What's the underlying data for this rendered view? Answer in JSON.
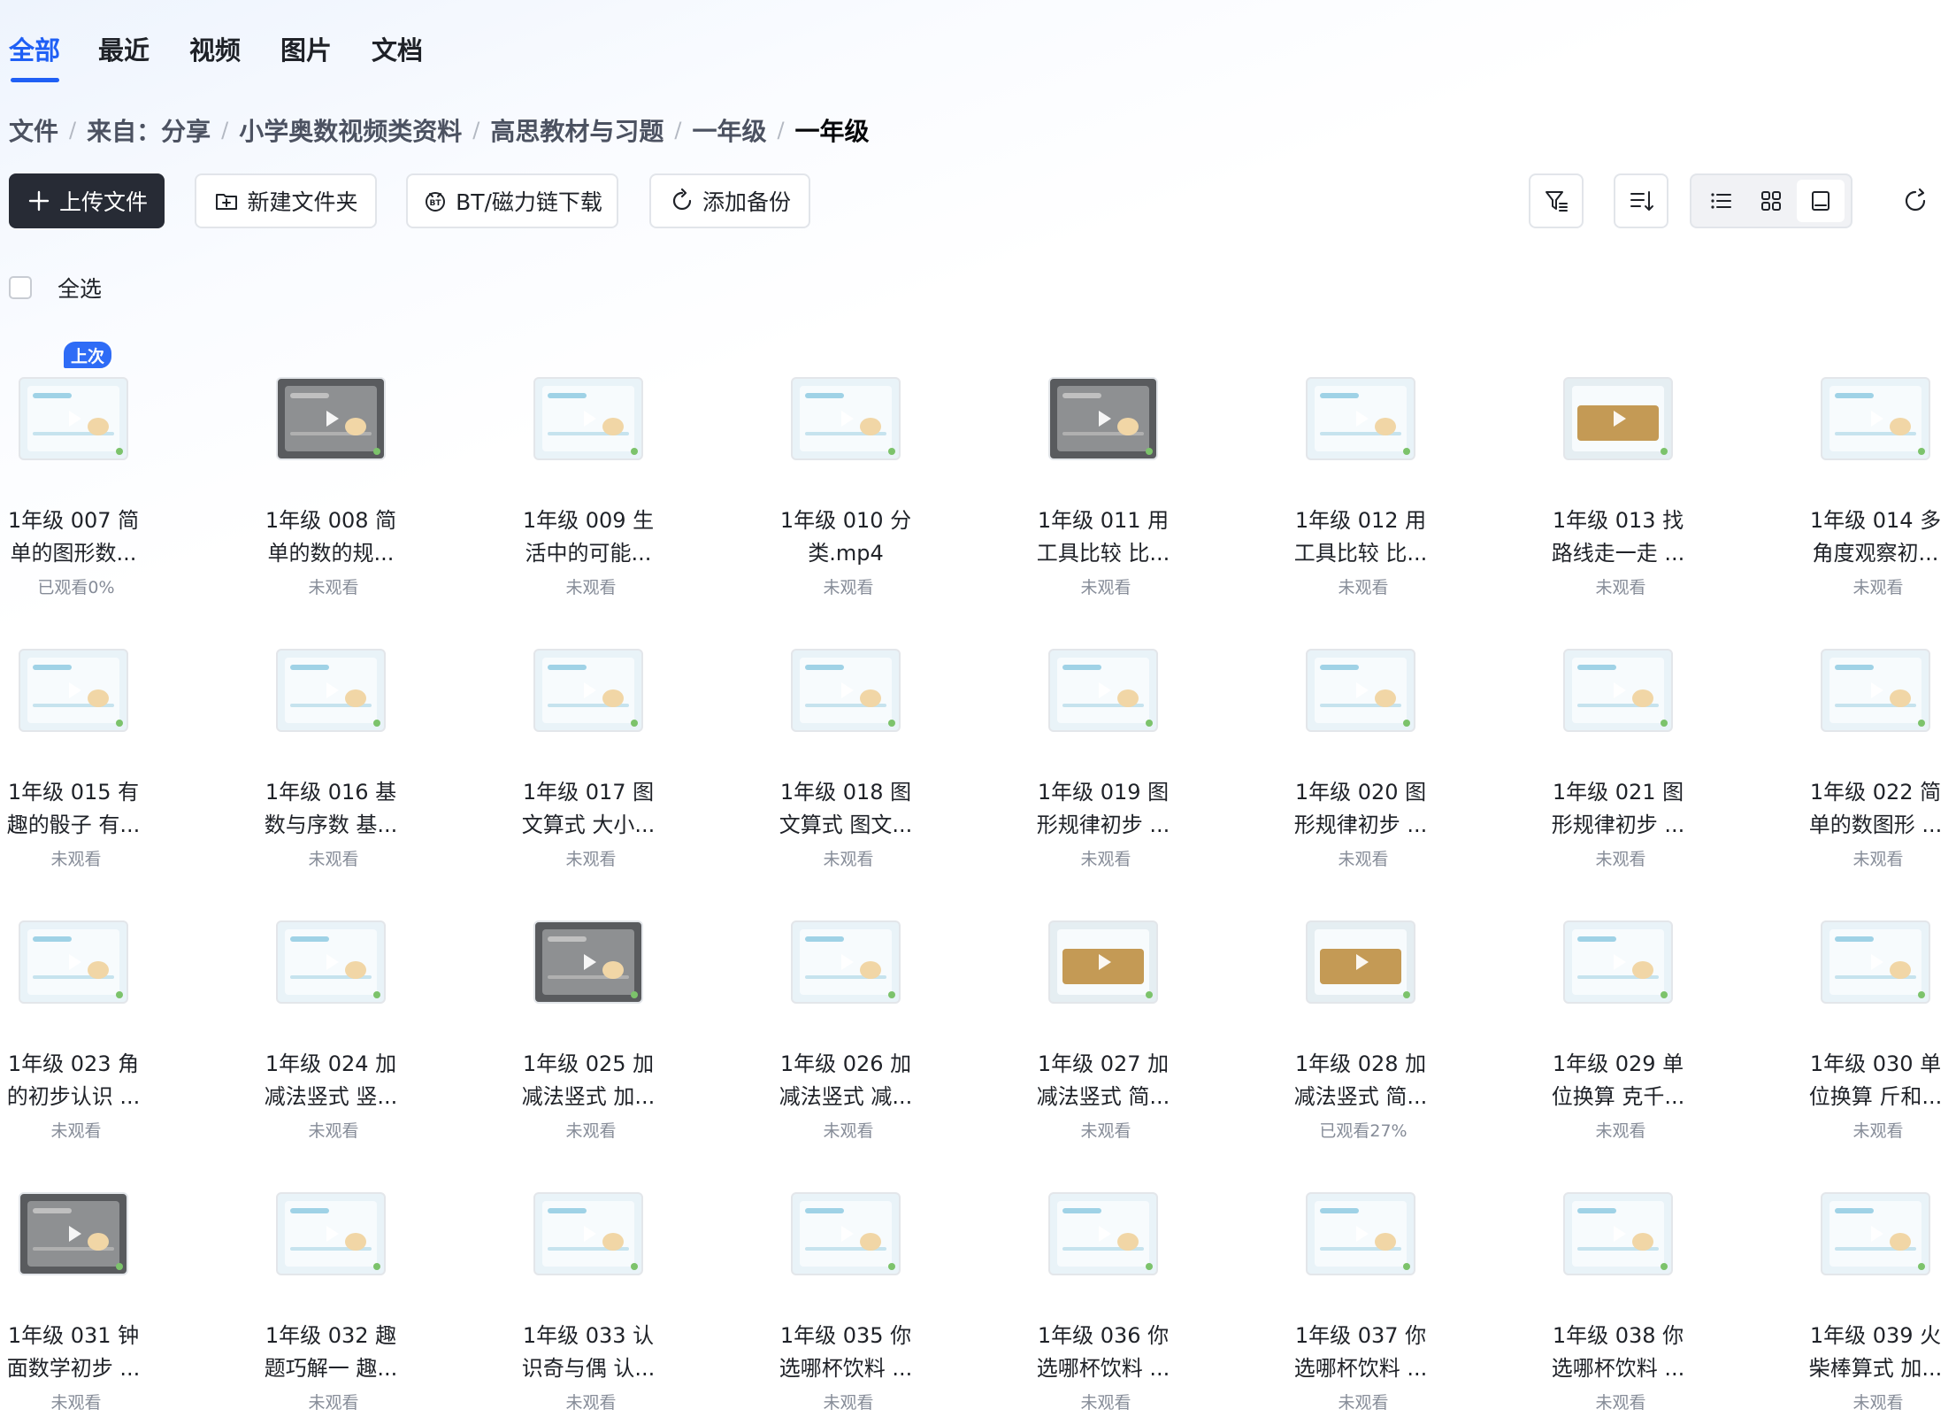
{
  "tabs": [
    {
      "label": "全部",
      "active": true
    },
    {
      "label": "最近",
      "active": false
    },
    {
      "label": "视频",
      "active": false
    },
    {
      "label": "图片",
      "active": false
    },
    {
      "label": "文档",
      "active": false
    }
  ],
  "breadcrumb": [
    "文件",
    "来自：分享",
    "小学奥数视频类资料",
    "高思教材与习题",
    "一年级",
    "一年级"
  ],
  "toolbar": {
    "upload_label": "上传文件",
    "new_folder_label": "新建文件夹",
    "bt_label": "BT/磁力链下载",
    "backup_label": "添加备份",
    "active_view": "thumbnail"
  },
  "select_all_label": "全选",
  "last_badge": "上次",
  "colors": {
    "accent": "#1f5ff5",
    "primary_button": "#272b35",
    "status_gray": "#868c98"
  },
  "files": [
    {
      "name": "1年级 007 简\n单的图形数...",
      "status": "已观看0%",
      "thumb": "light",
      "last": true
    },
    {
      "name": "1年级 008 简\n单的数的规...",
      "status": "未观看",
      "thumb": "dark"
    },
    {
      "name": "1年级 009 生\n活中的可能...",
      "status": "未观看",
      "thumb": "light"
    },
    {
      "name": "1年级 010 分\n类.mp4",
      "status": "未观看",
      "thumb": "light"
    },
    {
      "name": "1年级 011 用\n工具比较 比...",
      "status": "未观看",
      "thumb": "dark"
    },
    {
      "name": "1年级 012 用\n工具比较 比...",
      "status": "未观看",
      "thumb": "light"
    },
    {
      "name": "1年级 013 找\n路线走一走 ...",
      "status": "未观看",
      "thumb": "wood"
    },
    {
      "name": "1年级 014 多\n角度观察初...",
      "status": "未观看",
      "thumb": "light"
    },
    {
      "name": "1年级 015 有\n趣的骰子 有...",
      "status": "未观看",
      "thumb": "light"
    },
    {
      "name": "1年级 016 基\n数与序数 基...",
      "status": "未观看",
      "thumb": "light"
    },
    {
      "name": "1年级 017 图\n文算式 大小...",
      "status": "未观看",
      "thumb": "light"
    },
    {
      "name": "1年级 018 图\n文算式 图文...",
      "status": "未观看",
      "thumb": "light"
    },
    {
      "name": "1年级 019 图\n形规律初步 ...",
      "status": "未观看",
      "thumb": "light"
    },
    {
      "name": "1年级 020 图\n形规律初步 ...",
      "status": "未观看",
      "thumb": "light"
    },
    {
      "name": "1年级 021 图\n形规律初步 ...",
      "status": "未观看",
      "thumb": "light"
    },
    {
      "name": "1年级 022 简\n单的数图形 ...",
      "status": "未观看",
      "thumb": "light"
    },
    {
      "name": "1年级 023 角\n的初步认识 ...",
      "status": "未观看",
      "thumb": "light"
    },
    {
      "name": "1年级 024 加\n减法竖式 竖...",
      "status": "未观看",
      "thumb": "light"
    },
    {
      "name": "1年级 025 加\n减法竖式 加...",
      "status": "未观看",
      "thumb": "dark"
    },
    {
      "name": "1年级 026 加\n减法竖式 减...",
      "status": "未观看",
      "thumb": "light"
    },
    {
      "name": "1年级 027 加\n减法竖式 简...",
      "status": "未观看",
      "thumb": "wood"
    },
    {
      "name": "1年级 028 加\n减法竖式 简...",
      "status": "已观看27%",
      "thumb": "wood"
    },
    {
      "name": "1年级 029 单\n位换算 克千...",
      "status": "未观看",
      "thumb": "light"
    },
    {
      "name": "1年级 030 单\n位换算 斤和...",
      "status": "未观看",
      "thumb": "light"
    },
    {
      "name": "1年级 031 钟\n面数学初步 ...",
      "status": "未观看",
      "thumb": "dark"
    },
    {
      "name": "1年级 032 趣\n题巧解一 趣...",
      "status": "未观看",
      "thumb": "light"
    },
    {
      "name": "1年级 033 认\n识奇与偶 认...",
      "status": "未观看",
      "thumb": "light"
    },
    {
      "name": "1年级 035 你\n选哪杯饮料 ...",
      "status": "未观看",
      "thumb": "light"
    },
    {
      "name": "1年级 036 你\n选哪杯饮料 ...",
      "status": "未观看",
      "thumb": "light"
    },
    {
      "name": "1年级 037 你\n选哪杯饮料 ...",
      "status": "未观看",
      "thumb": "light"
    },
    {
      "name": "1年级 038 你\n选哪杯饮料 ...",
      "status": "未观看",
      "thumb": "light"
    },
    {
      "name": "1年级 039 火\n柴棒算式 加...",
      "status": "未观看",
      "thumb": "light"
    }
  ]
}
